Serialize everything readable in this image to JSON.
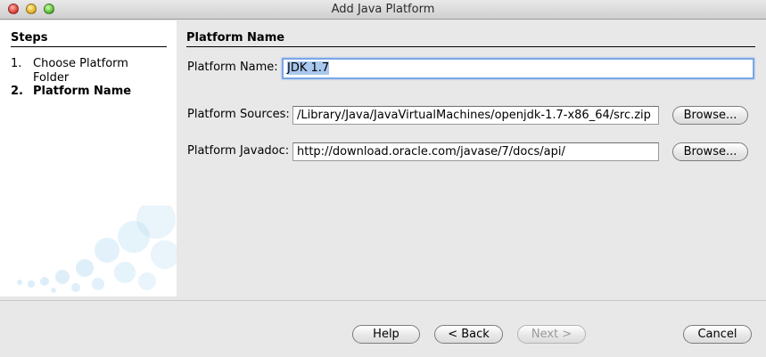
{
  "window": {
    "title": "Add Java Platform"
  },
  "steps": {
    "title": "Steps",
    "items": [
      {
        "num": "1.",
        "label": "Choose Platform Folder"
      },
      {
        "num": "2.",
        "label": "Platform Name"
      }
    ]
  },
  "main": {
    "header": "Platform Name",
    "name_label": "Platform Name:",
    "name_value": "JDK 1.7",
    "sources_label": "Platform Sources:",
    "sources_value": "/Library/Java/JavaVirtualMachines/openjdk-1.7-x86_64/src.zip",
    "javadoc_label": "Platform Javadoc:",
    "javadoc_value": "http://download.oracle.com/javase/7/docs/api/",
    "browse_label": "Browse..."
  },
  "footer": {
    "help": "Help",
    "back": "< Back",
    "next": "Next >",
    "cancel": "Cancel"
  },
  "colors": {
    "selection": "#a9c8ef",
    "focus_ring": "#7aa7e6"
  }
}
